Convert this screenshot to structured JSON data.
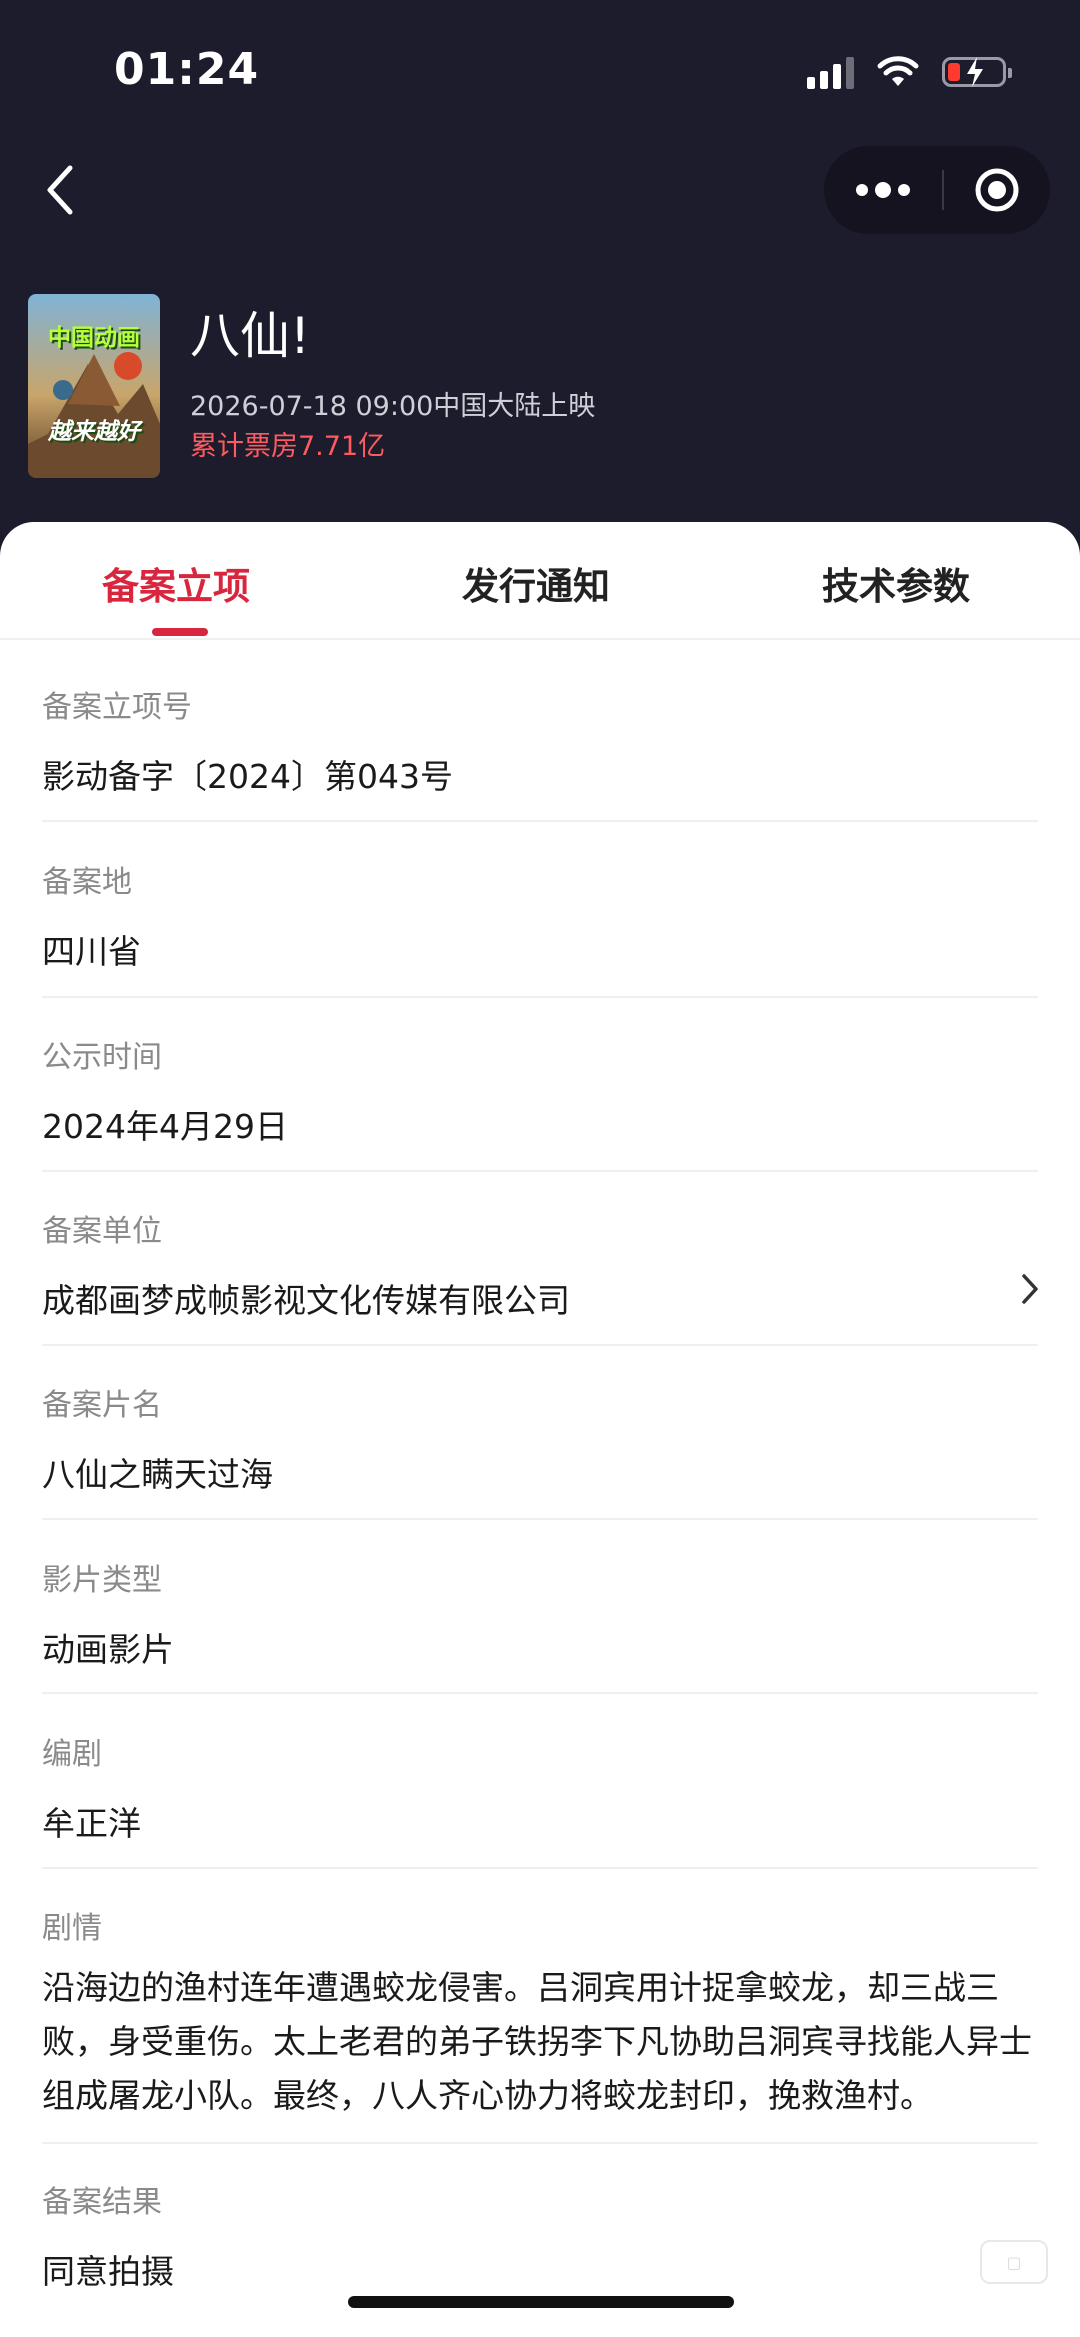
{
  "status_bar": {
    "time": "01:24"
  },
  "nav": {
    "back_icon": "chevron-left-icon",
    "more_icon": "more-dots-icon",
    "close_icon": "target-circle-icon"
  },
  "movie": {
    "poster_text_top": "中国动画",
    "poster_text_bottom": "越来越好",
    "title": "八仙!",
    "release": "2026-07-18 09:00中国大陆上映",
    "box_office": "累计票房7.71亿"
  },
  "tabs": [
    {
      "label": "备案立项",
      "active": true
    },
    {
      "label": "发行通知",
      "active": false
    },
    {
      "label": "技术参数",
      "active": false
    }
  ],
  "fields": [
    {
      "label": "备案立项号",
      "value": "影动备字〔2024〕第043号"
    },
    {
      "label": "备案地",
      "value": "四川省"
    },
    {
      "label": "公示时间",
      "value": "2024年4月29日"
    },
    {
      "label": "备案单位",
      "value": "成都画梦成帧影视文化传媒有限公司"
    },
    {
      "label": "备案片名",
      "value": "八仙之瞒天过海"
    },
    {
      "label": "影片类型",
      "value": "动画影片"
    },
    {
      "label": "编剧",
      "value": "牟正洋"
    },
    {
      "label": "剧情",
      "value": "沿海边的渔村连年遭遇蛟龙侵害。吕洞宾用计捉拿蛟龙，却三战三败，身受重伤。太上老君的弟子铁拐李下凡协助吕洞宾寻找能人异士组成屠龙小队。最终，八人齐心协力将蛟龙封印，挽救渔村。"
    },
    {
      "label": "备案结果",
      "value": "同意拍摄"
    }
  ],
  "colors": {
    "accent": "#d7263d",
    "header_bg": "#1d1c2c",
    "box_office": "#ff5a5f"
  }
}
